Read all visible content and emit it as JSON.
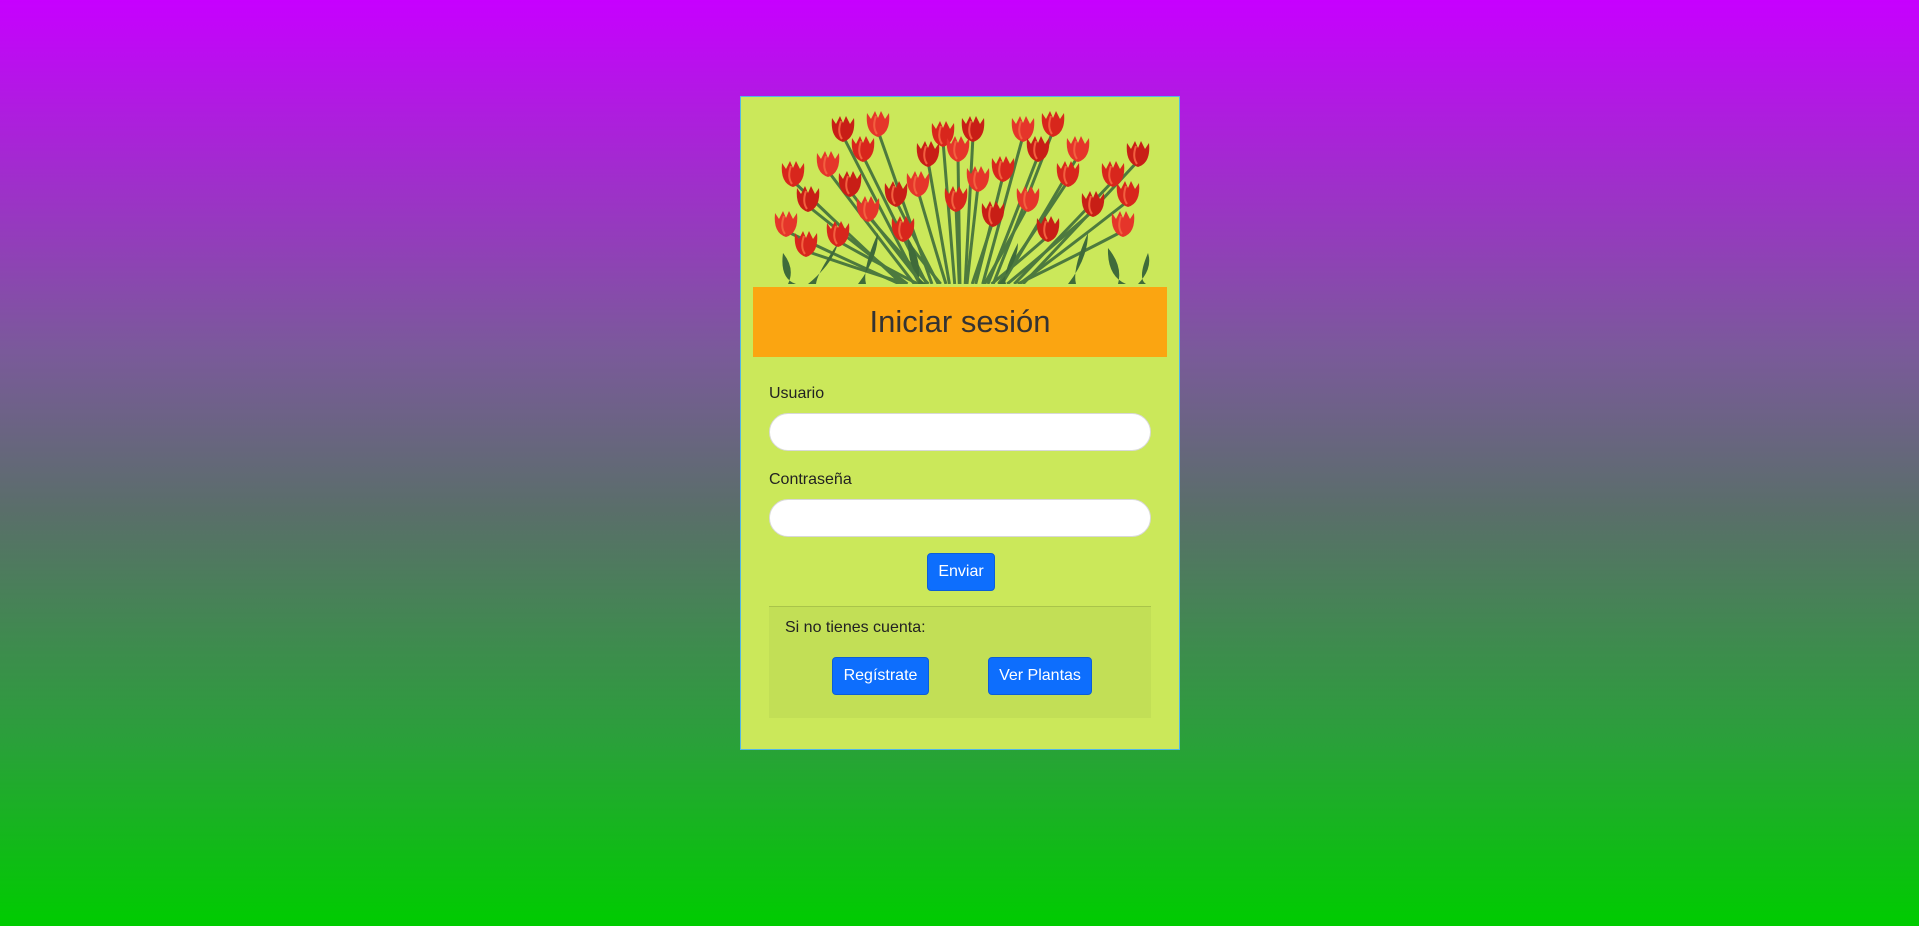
{
  "login": {
    "title": "Iniciar sesión",
    "username_label": "Usuario",
    "username_value": "",
    "password_label": "Contraseña",
    "password_value": "",
    "submit_label": "Enviar"
  },
  "signup": {
    "prompt": "Si no tienes cuenta:",
    "register_label": "Regístrate",
    "view_plants_label": "Ver Plantas"
  },
  "colors": {
    "card_background": "#cbe85a",
    "title_bar": "#fba511",
    "button": "#0d6efd",
    "gradient_top": "#c700ff",
    "gradient_bottom": "#00cc00"
  },
  "images": {
    "hero": "red-tulips-image"
  }
}
